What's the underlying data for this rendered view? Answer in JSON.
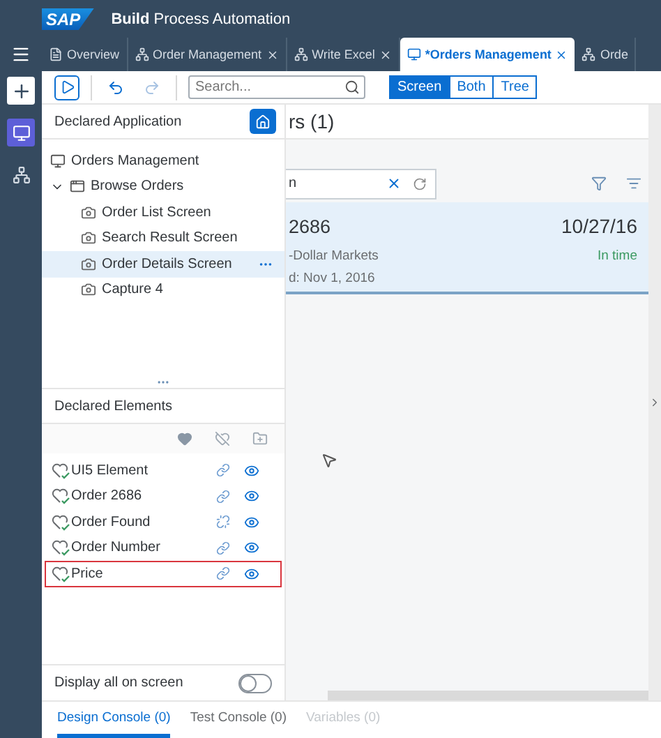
{
  "header": {
    "logo": "SAP",
    "title_bold": "Build",
    "title": "Process Automation"
  },
  "tabs": [
    {
      "label": "Overview",
      "kind": "document",
      "selected": false,
      "closable": false
    },
    {
      "label": "Order Management",
      "kind": "process",
      "selected": false,
      "closable": true
    },
    {
      "label": "Write Excel",
      "kind": "process",
      "selected": false,
      "closable": true
    },
    {
      "label": "*Orders Management",
      "kind": "screen",
      "selected": true,
      "closable": true
    },
    {
      "label": "Orde",
      "kind": "process",
      "selected": false,
      "closable": false
    }
  ],
  "rail": [
    {
      "kind": "add",
      "selected": false
    },
    {
      "kind": "screen",
      "selected": true
    },
    {
      "kind": "process",
      "selected": false
    }
  ],
  "toolbar": {
    "search": {
      "placeholder": "Search..."
    },
    "views": [
      {
        "label": "Screen",
        "selected": true
      },
      {
        "label": "Both",
        "selected": false
      },
      {
        "label": "Tree",
        "selected": false
      }
    ]
  },
  "declared_application": {
    "title": "Declared Application",
    "tree": [
      {
        "label": "Orders Management",
        "kind": "application",
        "selected": false
      },
      {
        "label": "Browse Orders",
        "kind": "page",
        "expanded": true,
        "selected": false,
        "children": [
          {
            "label": "Order List Screen",
            "kind": "screen",
            "selected": false
          },
          {
            "label": "Search Result Screen",
            "kind": "screen",
            "selected": false
          },
          {
            "label": "Order Details Screen",
            "kind": "screen",
            "selected": true
          },
          {
            "label": "Capture 4",
            "kind": "screen",
            "selected": false
          }
        ]
      }
    ]
  },
  "declared_elements": {
    "title": "Declared Elements",
    "items": [
      {
        "label": "UI5 Element",
        "linked": true,
        "highlighted": false
      },
      {
        "label": "Order 2686",
        "linked": true,
        "highlighted": false
      },
      {
        "label": "Order Found",
        "linked": false,
        "highlighted": false
      },
      {
        "label": "Order Number",
        "linked": true,
        "highlighted": false
      },
      {
        "label": "Price",
        "linked": true,
        "highlighted": true
      }
    ]
  },
  "display_all": {
    "label": "Display all on screen",
    "on": false
  },
  "preview": {
    "title": "rs (1)",
    "search": {
      "value": "n"
    },
    "item": {
      "title": "2686",
      "date": "10/27/16",
      "line_2": "-Dollar Markets",
      "status": "In time",
      "line_3": "d: Nov 1, 2016",
      "selected": true
    }
  },
  "console_tabs": [
    {
      "label": "Design Console (0)",
      "selected": true,
      "disabled": false
    },
    {
      "label": "Test Console (0)",
      "selected": false,
      "disabled": false
    },
    {
      "label": "Variables (0)",
      "selected": false,
      "disabled": true
    }
  ]
}
